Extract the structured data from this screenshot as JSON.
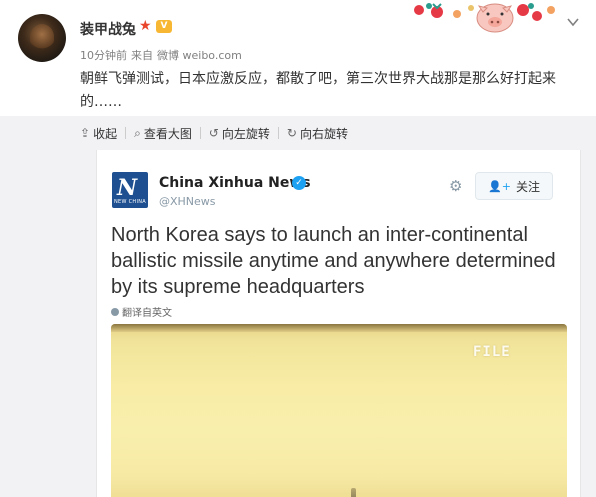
{
  "post": {
    "username": "装甲战兔",
    "vip_badge": "V",
    "time": "10分钟前",
    "source_prefix": "来自",
    "source": "微博 weibo.com",
    "text": "朝鲜飞弹测试，日本应激反应，都散了吧，第三次世界大战那是那么好打起来的……"
  },
  "toolbar": {
    "collapse": "收起",
    "view_large": "查看大图",
    "rotate_left": "向左旋转",
    "rotate_right": "向右旋转"
  },
  "tweet": {
    "logo_letter": "N",
    "logo_sub": "NEW CHINA",
    "name": "China Xinhua News",
    "verified_mark": "✓",
    "handle": "@XHNews",
    "follow_label": "关注",
    "text": "North Korea says to launch an inter-continental ballistic missile anytime and anywhere determined by its supreme headquarters",
    "translate_label": "翻译自英文",
    "media_label": "FILE"
  },
  "colors": {
    "accent_blue": "#1da1f2",
    "xinhua_blue": "#1d4f91",
    "star_red": "#e8452b",
    "vip_orange": "#f7b733"
  },
  "icons": [
    "chevron-down-icon",
    "star-icon",
    "vip-icon",
    "collapse-icon",
    "search-icon",
    "rotate-left-icon",
    "rotate-right-icon",
    "verified-icon",
    "gear-icon",
    "add-person-icon",
    "globe-icon"
  ]
}
